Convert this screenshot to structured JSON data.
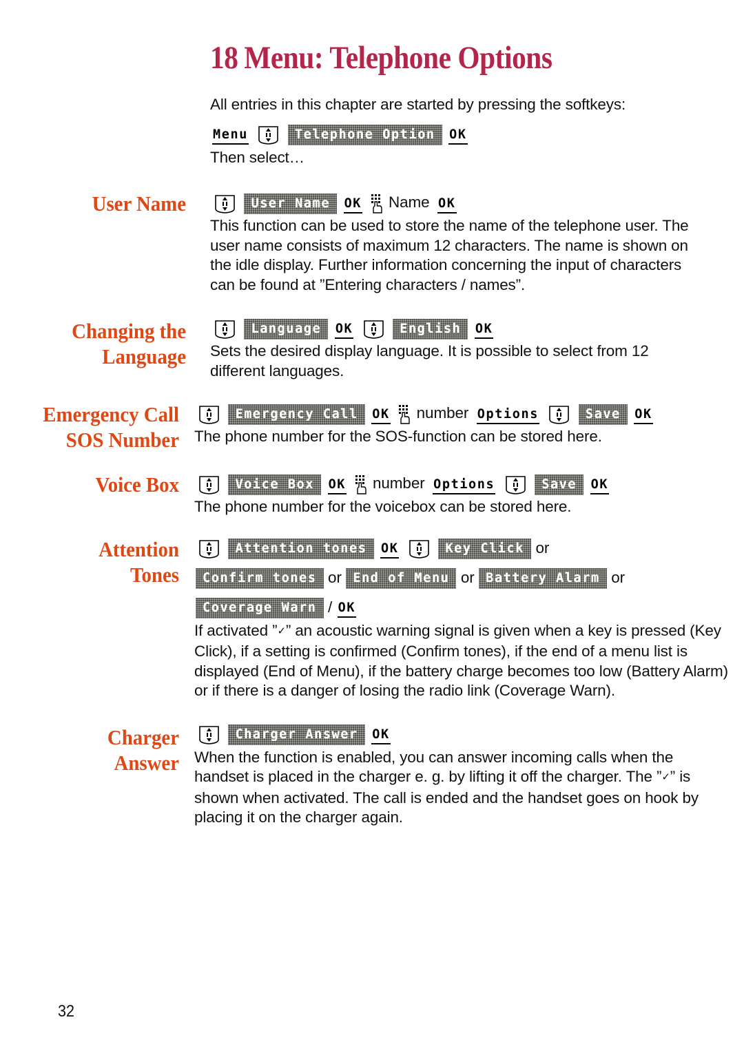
{
  "document": {
    "chapter_number": "18",
    "chapter_title": "Menu: Telephone Options",
    "page_number": "32",
    "title_color": "#b4254a",
    "heading_color": "#dd4814",
    "lcd_chip_color": "#54544f"
  },
  "intro": {
    "lead": "All entries in this chapter are started by pressing the softkeys:",
    "sequence": {
      "menu_key": "Menu",
      "nav_icon": "nav-updown-icon",
      "telephone_option_chip": "Telephone Option",
      "ok_key": "OK"
    },
    "then_select": "Then select…"
  },
  "sections": [
    {
      "heading_lines": [
        "User Name"
      ],
      "sequence": {
        "nav_icon": "nav-updown-icon",
        "chip": "User Name",
        "ok1": "OK",
        "keypad_icon": "keypad-hand-icon",
        "word": "Name",
        "ok2": "OK"
      },
      "body": "This function can be used to store the name of the telephone user. The user name consists of maximum 12 characters. The name is shown on the idle display. Further information concerning the input of characters can be found at ”Entering characters / names”."
    },
    {
      "heading_lines": [
        "Changing the",
        "Language"
      ],
      "sequence": {
        "nav_icon1": "nav-updown-icon",
        "chip1": "Language",
        "ok1": "OK",
        "nav_icon2": "nav-updown-icon",
        "chip2": "English",
        "ok2": "OK"
      },
      "body": "Sets the desired display language. It is possible to select from 12 different languages."
    },
    {
      "heading_lines": [
        "Emergency Call",
        "SOS Number"
      ],
      "sequence": {
        "nav_icon1": "nav-updown-icon",
        "chip1": "Emergency Call",
        "ok1": "OK",
        "keypad_icon": "keypad-hand-icon",
        "word": "number",
        "options": "Options",
        "nav_icon2": "nav-updown-icon",
        "chip2": "Save",
        "ok2": "OK"
      },
      "body": "The phone number for the SOS-function can be stored here."
    },
    {
      "heading_lines": [
        "Voice Box"
      ],
      "sequence": {
        "nav_icon1": "nav-updown-icon",
        "chip1": "Voice Box",
        "ok1": "OK",
        "keypad_icon": "keypad-hand-icon",
        "word": "number",
        "options": "Options",
        "nav_icon2": "nav-updown-icon",
        "chip2": "Save",
        "ok2": "OK"
      },
      "body": "The phone number for the voicebox can be stored here."
    },
    {
      "heading_lines": [
        "Attention",
        "Tones"
      ],
      "sequence": {
        "nav_icon1": "nav-updown-icon",
        "chip1": "Attention tones",
        "ok1": "OK",
        "nav_icon2": "nav-updown-icon",
        "chip2": "Key Click",
        "or1": "or",
        "chip3": "Confirm tones",
        "or2": "or",
        "chip4": "End of Menu",
        "or3": "or",
        "chip5": "Battery Alarm",
        "or4": "or",
        "chip6": "Coverage Warn",
        "slash": "/",
        "ok2": "OK"
      },
      "body_pre": "If activated ”",
      "body_tick": "✓",
      "body_post": "” an acoustic warning signal is given when a key is pressed (Key Click), if a setting is confirmed (Confirm tones), if the end of a menu list is displayed (End of Menu), if the battery charge becomes too low (Battery Alarm) or if there is a danger of losing the radio link (Coverage Warn)."
    },
    {
      "heading_lines": [
        "Charger",
        "Answer"
      ],
      "sequence": {
        "nav_icon1": "nav-updown-icon",
        "chip1": "Charger Answer",
        "ok1": "OK"
      },
      "body_pre": "When the function is enabled, you can answer incoming calls when the handset is placed in the charger e. g. by lifting it off the charger. The ”",
      "body_tick": "✓",
      "body_post": "” is shown when activated. The call is ended and the handset goes on hook by placing it on the charger again."
    }
  ]
}
